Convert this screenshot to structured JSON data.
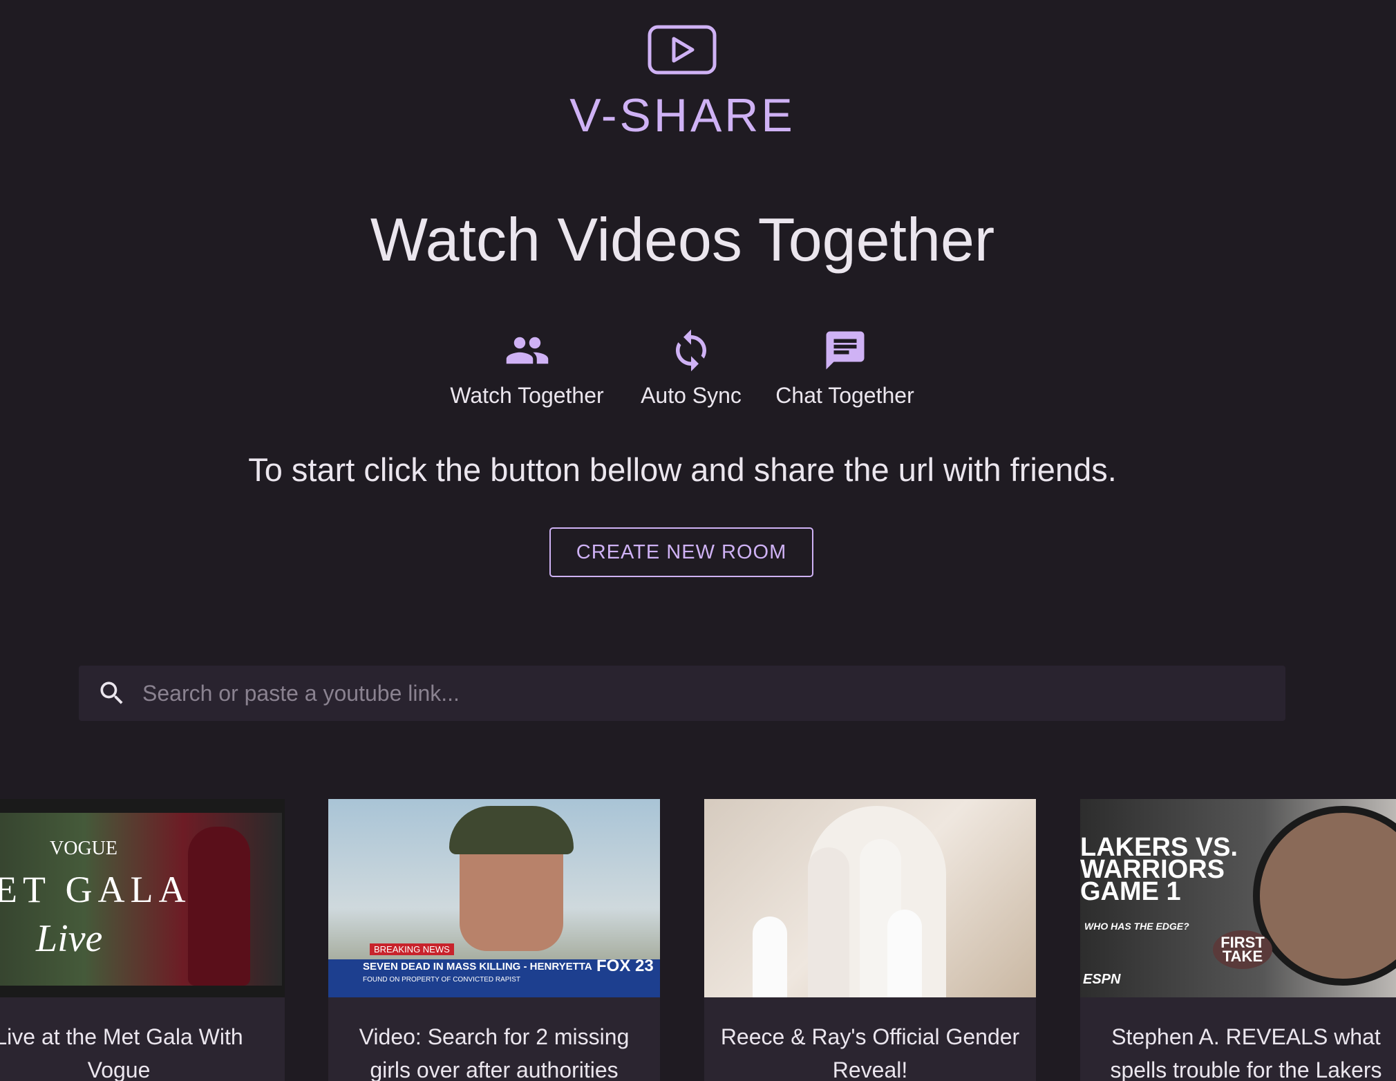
{
  "brand": {
    "name": "V-SHARE",
    "accent": "#cfb2f5"
  },
  "hero": {
    "headline": "Watch Videos Together"
  },
  "features": [
    {
      "icon": "people-icon",
      "label": "Watch Together"
    },
    {
      "icon": "sync-icon",
      "label": "Auto Sync"
    },
    {
      "icon": "chat-icon",
      "label": "Chat Together"
    }
  ],
  "tagline": "To start click the button bellow and share the url with friends.",
  "create_button": {
    "label": "CREATE NEW ROOM"
  },
  "search": {
    "placeholder": "Search or paste a youtube link..."
  },
  "videos": [
    {
      "title": "Live at the Met Gala With Vogue",
      "thumb_text": [
        "VOGUE",
        "ET GALA",
        "Live"
      ]
    },
    {
      "title": "Video: Search for 2 missing girls over after authorities",
      "thumb_text": [
        "BREAKING NEWS",
        "SEVEN DEAD IN MASS KILLING - HENRYETTA",
        "FOUND ON PROPERTY OF CONVICTED RAPIST",
        "FOX 23"
      ]
    },
    {
      "title": "Reece & Ray's Official Gender Reveal!",
      "thumb_text": []
    },
    {
      "title": "Stephen A. REVEALS what spells trouble for the Lakers",
      "thumb_text": [
        "LAKERS VS. WARRIORS GAME 1",
        "WHO HAS THE EDGE?",
        "FIRST TAKE",
        "ESPN"
      ]
    }
  ]
}
